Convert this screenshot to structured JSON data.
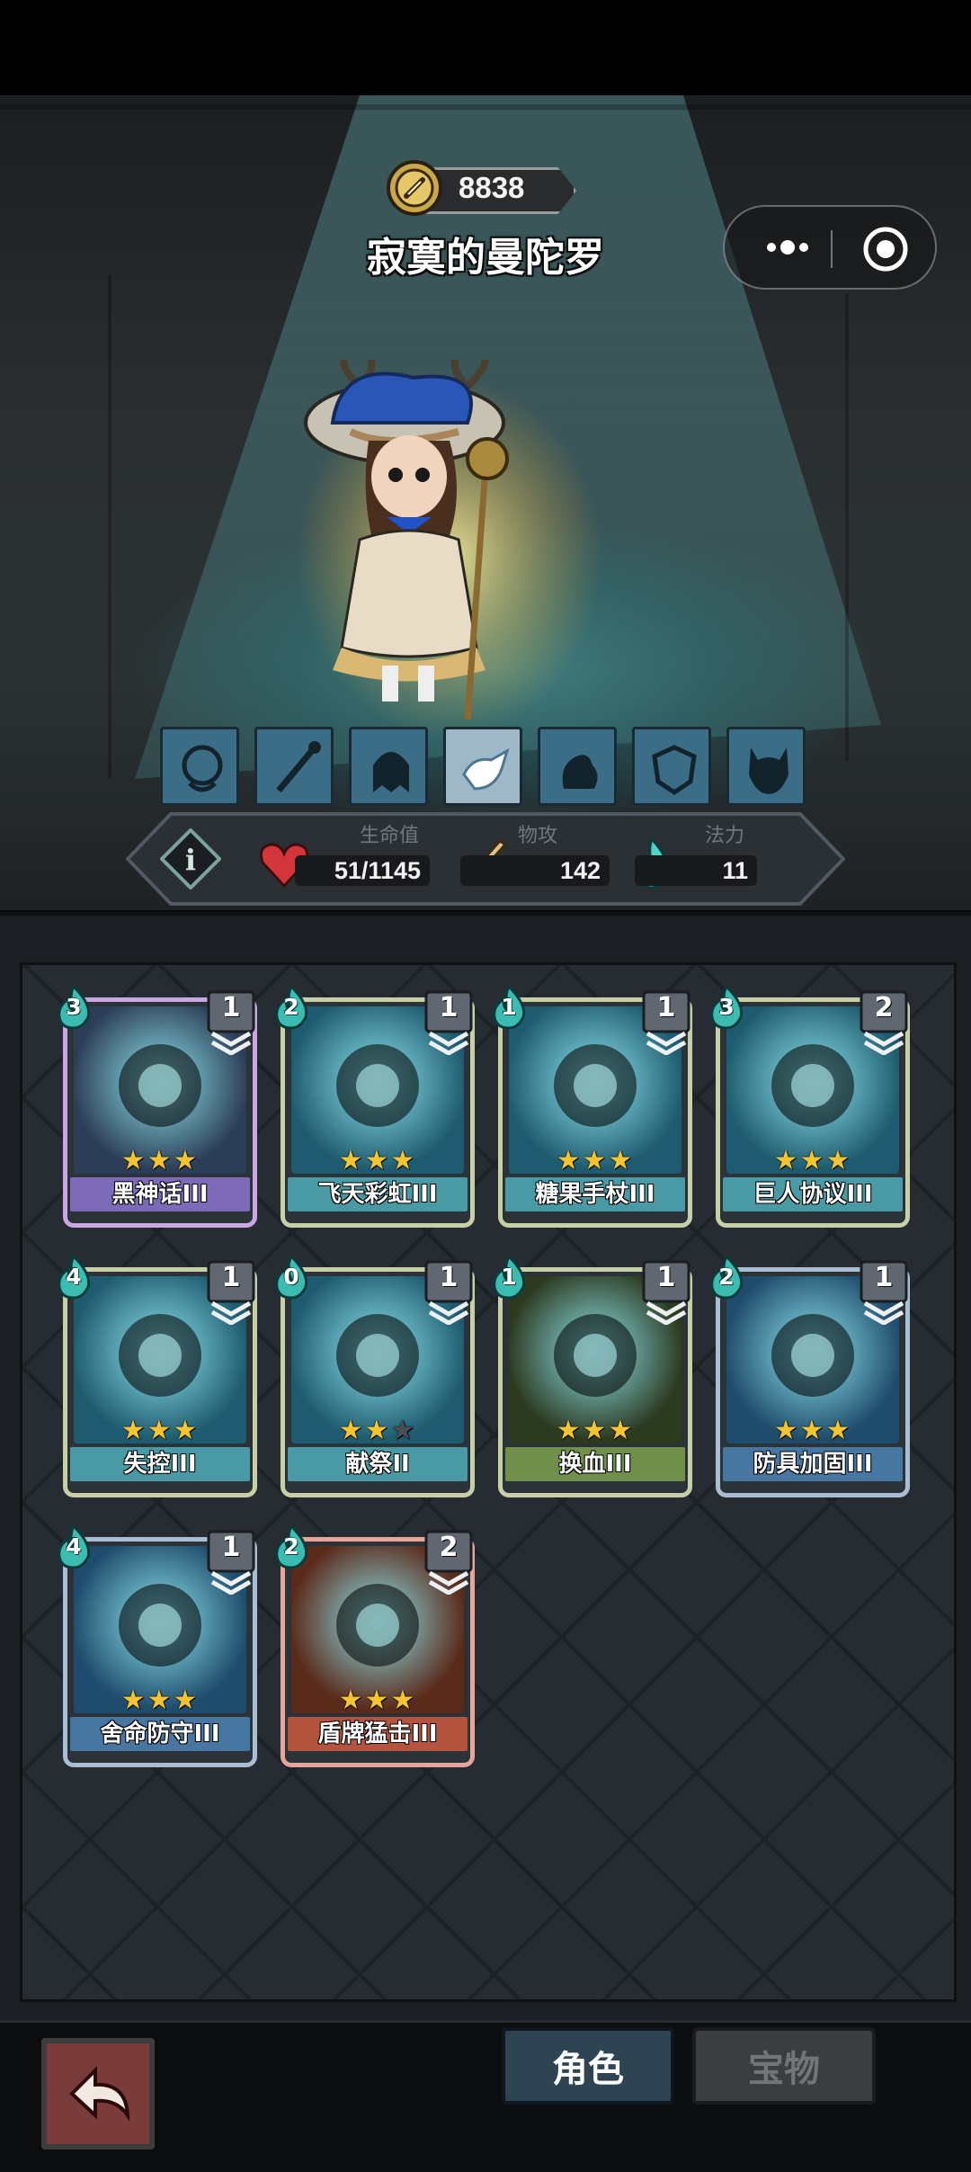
{
  "header": {
    "gold": "8838",
    "hero_name": "寂寞的曼陀罗"
  },
  "capsule": {
    "more_icon": "more-dots-icon",
    "close_icon": "target-circle-icon"
  },
  "skills": [
    {
      "icon": "swirl-creature-icon",
      "active": false
    },
    {
      "icon": "staff-icon",
      "active": false
    },
    {
      "icon": "ghost-icon",
      "active": false
    },
    {
      "icon": "hand-grab-icon",
      "active": true
    },
    {
      "icon": "muscle-arm-icon",
      "active": false
    },
    {
      "icon": "shield-shards-icon",
      "active": false
    },
    {
      "icon": "demon-head-icon",
      "active": false
    }
  ],
  "stats": {
    "hp_label": "生命值",
    "hp_value": "51/1145",
    "atk_label": "物攻",
    "atk_value": "142",
    "mana_label": "法力",
    "mana_value": "11"
  },
  "cards": [
    {
      "cost": "3",
      "level": "1",
      "stars": 3,
      "name": "黑神话III",
      "theme": "purple"
    },
    {
      "cost": "2",
      "level": "1",
      "stars": 3,
      "name": "飞天彩虹III",
      "theme": "teal"
    },
    {
      "cost": "1",
      "level": "1",
      "stars": 3,
      "name": "糖果手杖III",
      "theme": "teal"
    },
    {
      "cost": "3",
      "level": "2",
      "stars": 3,
      "name": "巨人协议III",
      "theme": "teal"
    },
    {
      "cost": "4",
      "level": "1",
      "stars": 3,
      "name": "失控III",
      "theme": "teal"
    },
    {
      "cost": "0",
      "level": "1",
      "stars": 2,
      "name": "献祭II",
      "theme": "teal"
    },
    {
      "cost": "1",
      "level": "1",
      "stars": 3,
      "name": "换血III",
      "theme": "green"
    },
    {
      "cost": "2",
      "level": "1",
      "stars": 3,
      "name": "防具加固III",
      "theme": "blue"
    },
    {
      "cost": "4",
      "level": "1",
      "stars": 3,
      "name": "舍命防守III",
      "theme": "blue"
    },
    {
      "cost": "2",
      "level": "2",
      "stars": 3,
      "name": "盾牌猛击III",
      "theme": "red"
    }
  ],
  "nav": {
    "back_icon": "back-arrow-icon",
    "tab_role": "角色",
    "tab_treasure": "宝物"
  }
}
